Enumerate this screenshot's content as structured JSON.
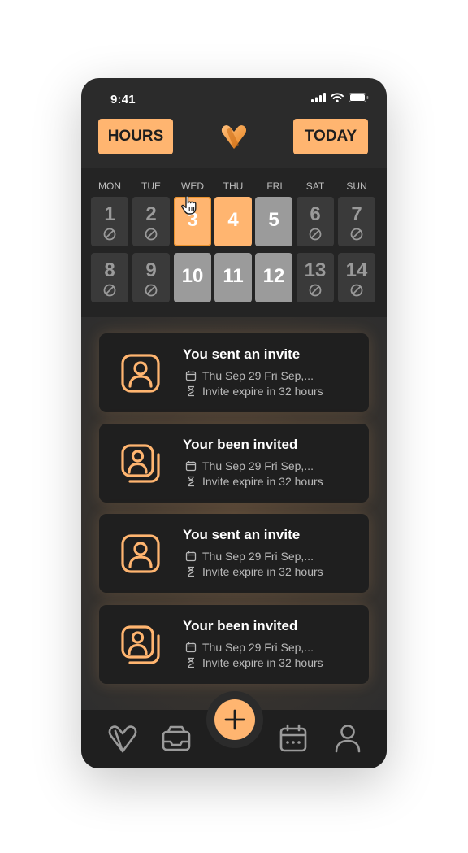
{
  "status_bar": {
    "time": "9:41"
  },
  "header": {
    "hours_label": "HOURS",
    "today_label": "TODAY"
  },
  "calendar": {
    "weekdays": [
      "MON",
      "TUE",
      "WED",
      "THU",
      "FRI",
      "SAT",
      "SUN"
    ],
    "week1": [
      "1",
      "2",
      "3",
      "4",
      "5",
      "6",
      "7"
    ],
    "week2": [
      "8",
      "9",
      "10",
      "11",
      "12",
      "13",
      "14"
    ]
  },
  "invites": [
    {
      "title": "You sent an invite",
      "date": "Thu Sep 29 Fri Sep,...",
      "expiry": "Invite expire in 32 hours",
      "icon": "single-user-icon"
    },
    {
      "title": "Your been invited",
      "date": "Thu Sep 29 Fri Sep,...",
      "expiry": "Invite expire in 32 hours",
      "icon": "stacked-users-icon"
    },
    {
      "title": "You sent an invite",
      "date": "Thu Sep 29 Fri Sep,...",
      "expiry": "Invite expire in 32 hours",
      "icon": "single-user-icon"
    },
    {
      "title": "Your been invited",
      "date": "Thu Sep 29 Fri Sep,...",
      "expiry": "Invite expire in 32 hours",
      "icon": "stacked-users-icon"
    }
  ],
  "nav": [
    "heart-logo-icon",
    "inbox-icon",
    "plus-icon",
    "calendar-icon",
    "profile-icon"
  ],
  "colors": {
    "accent": "#ffb570",
    "background": "#2b2b2b",
    "card": "#1f1f1f",
    "available_grey": "#9b9b9b"
  }
}
